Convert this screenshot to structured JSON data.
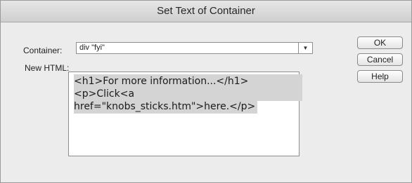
{
  "dialog": {
    "title": "Set Text of Container"
  },
  "container": {
    "label": "Container:",
    "selected": "div \"fyi\""
  },
  "new_html": {
    "label": "New HTML:",
    "lines": [
      "<h1>For more information...</h1>",
      "<p>Click<a",
      "href=\"knobs_sticks.htm\">here.</p>"
    ]
  },
  "buttons": {
    "ok": "OK",
    "cancel": "Cancel",
    "help": "Help"
  }
}
